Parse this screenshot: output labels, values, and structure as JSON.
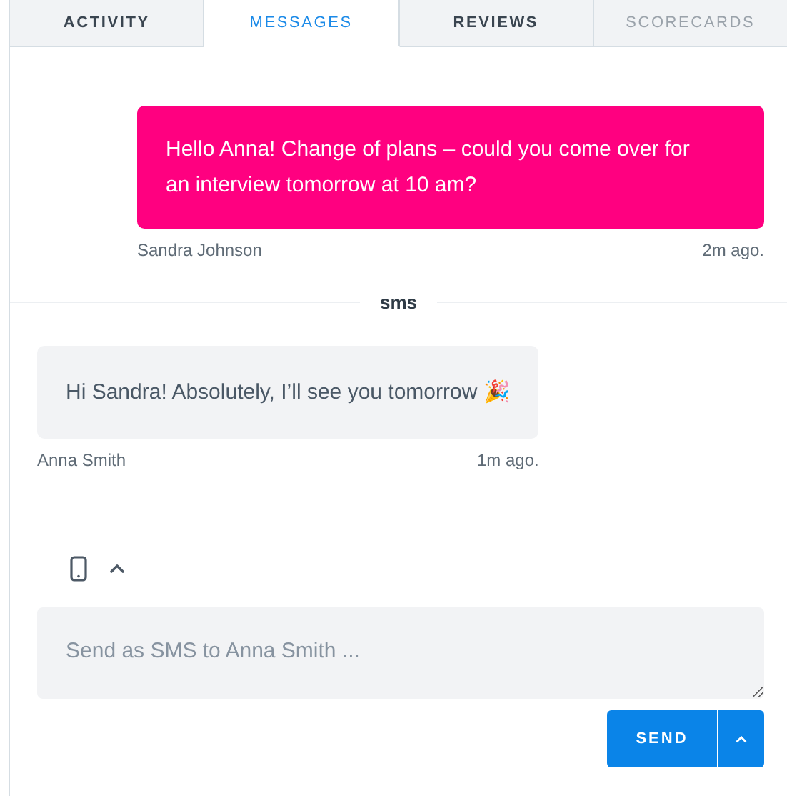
{
  "tabs": [
    {
      "label": "ACTIVITY",
      "selected": false,
      "disabled": false
    },
    {
      "label": "MESSAGES",
      "selected": true,
      "disabled": false
    },
    {
      "label": "REVIEWS",
      "selected": false,
      "disabled": false
    },
    {
      "label": "SCORECARDS",
      "selected": false,
      "disabled": true
    }
  ],
  "messages": [
    {
      "kind": "outgoing",
      "text": "Hello Anna! Change of plans – could you come over for an interview tomorrow at 10 am?",
      "sender": "Sandra Johnson",
      "time": "2m ago."
    },
    {
      "kind": "divider",
      "text": "sms"
    },
    {
      "kind": "incoming",
      "text": "Hi Sandra! Absolutely, I’ll see you tomorrow 🎉",
      "sender": "Anna Smith",
      "time": "1m ago."
    }
  ],
  "composer": {
    "placeholder": "Send as SMS to Anna Smith ...",
    "send_label": "SEND"
  }
}
